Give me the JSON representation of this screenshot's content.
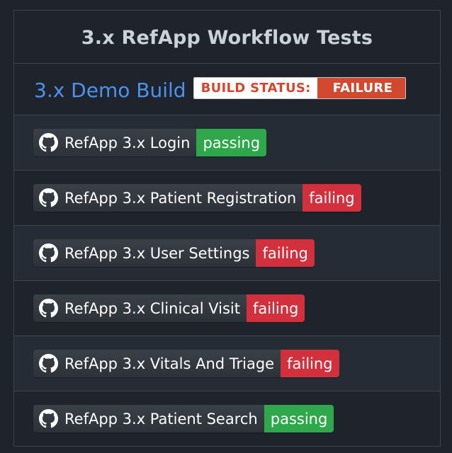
{
  "header": {
    "title": "3.x RefApp Workflow Tests"
  },
  "build": {
    "link_text": "3.x Demo Build",
    "badge_label": "BUILD STATUS:",
    "badge_value": "FAILURE"
  },
  "workflows": [
    {
      "label": "RefApp 3.x Login",
      "status": "passing"
    },
    {
      "label": "RefApp 3.x Patient Registration",
      "status": "failing"
    },
    {
      "label": "RefApp 3.x User Settings",
      "status": "failing"
    },
    {
      "label": "RefApp 3.x Clinical Visit",
      "status": "failing"
    },
    {
      "label": "RefApp 3.x Vitals And Triage",
      "status": "failing"
    },
    {
      "label": "RefApp 3.x Patient Search",
      "status": "passing"
    }
  ],
  "colors": {
    "passing": "#2ea84a",
    "failing": "#d3303d",
    "link": "#4b93ee",
    "build_failure": "#d2492f"
  },
  "icons": {
    "workflow_badge": "github-icon"
  }
}
